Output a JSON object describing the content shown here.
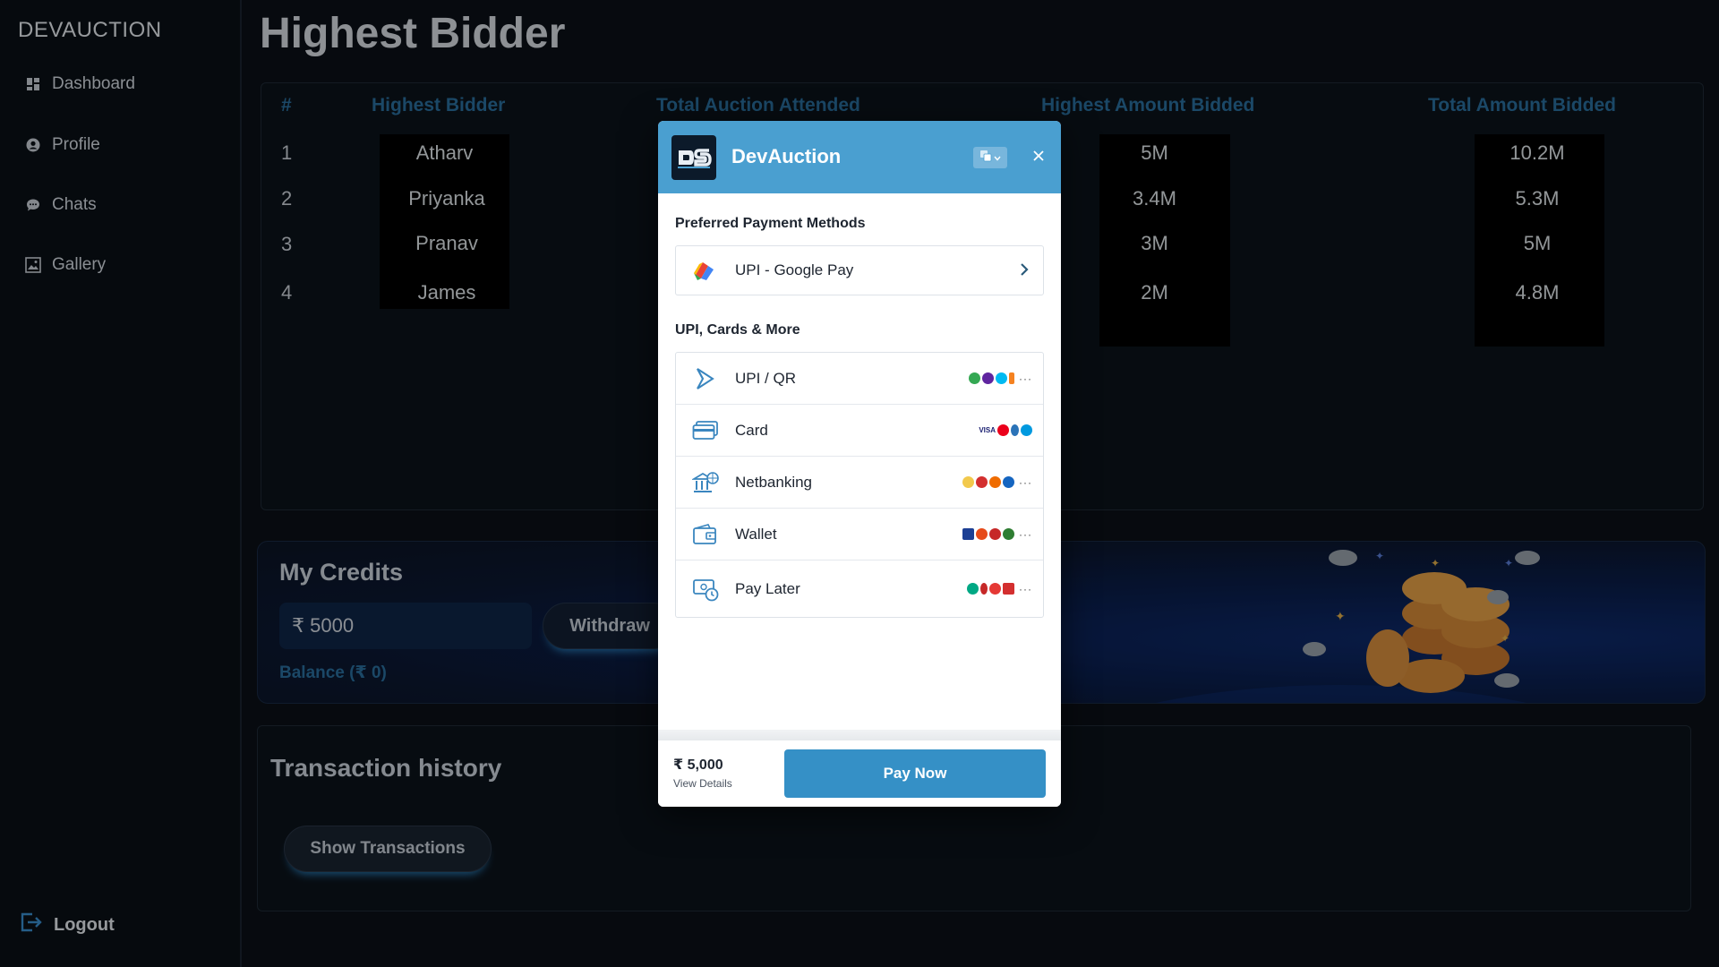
{
  "sidebar": {
    "brand": "DEVAUCTION",
    "items": [
      {
        "label": "Dashboard",
        "icon": "dashboard-icon"
      },
      {
        "label": "Profile",
        "icon": "profile-icon"
      },
      {
        "label": "Chats",
        "icon": "chat-icon"
      },
      {
        "label": "Gallery",
        "icon": "gallery-icon"
      }
    ],
    "logout": "Logout"
  },
  "page": {
    "title": "Highest Bidder"
  },
  "table": {
    "headers": [
      "#",
      "Highest Bidder",
      "Total Auction Attended",
      "Highest Amount Bidded",
      "Total Amount Bidded"
    ],
    "rows": [
      {
        "num": "1",
        "name": "Atharv",
        "highest": "5M",
        "total": "10.2M"
      },
      {
        "num": "2",
        "name": "Priyanka",
        "highest": "3.4M",
        "total": "5.3M"
      },
      {
        "num": "3",
        "name": "Pranav",
        "highest": "3M",
        "total": "5M"
      },
      {
        "num": "4",
        "name": "James",
        "highest": "2M",
        "total": "4.8M"
      }
    ]
  },
  "credits": {
    "title": "My Credits",
    "input_value": "₹ 5000",
    "withdraw_label": "Withdraw",
    "balance": "Balance (₹ 0)"
  },
  "transactions": {
    "title": "Transaction history",
    "show_label": "Show Transactions"
  },
  "modal": {
    "title": "DevAuction",
    "preferred_heading": "Preferred Payment Methods",
    "preferred_method": "UPI - Google Pay",
    "more_heading": "UPI, Cards & More",
    "methods": [
      {
        "label": "UPI / QR",
        "icon": "upi-icon"
      },
      {
        "label": "Card",
        "icon": "card-icon"
      },
      {
        "label": "Netbanking",
        "icon": "bank-icon"
      },
      {
        "label": "Wallet",
        "icon": "wallet-icon"
      },
      {
        "label": "Pay Later",
        "icon": "paylater-icon"
      }
    ],
    "amount": "₹ 5,000",
    "view_details": "View Details",
    "pay_label": "Pay Now"
  },
  "colors": {
    "accent": "#4a9fd0",
    "pay_button": "#3590c6",
    "header_text": "#2a6f9e",
    "background": "#0b1017"
  }
}
